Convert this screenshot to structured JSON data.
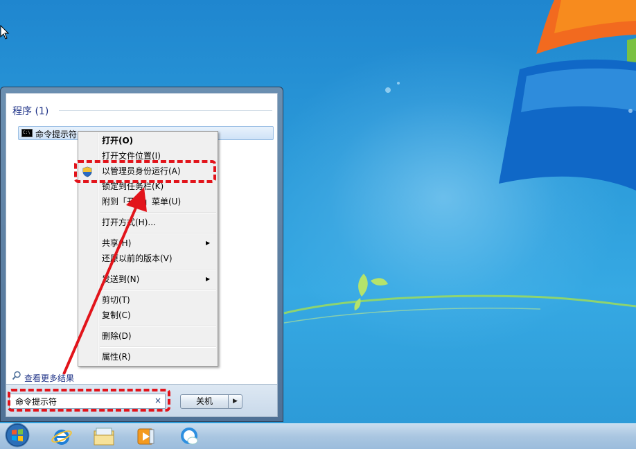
{
  "start_menu": {
    "group_header": "程序 (1)",
    "program_item": "命令提示符",
    "cmd_icon_text": "C:\\",
    "see_more": "查看更多结果",
    "search_value": "命令提示符",
    "search_clear": "×",
    "shutdown_label": "关机",
    "shutdown_arrow": "▶"
  },
  "context_menu": {
    "items": [
      {
        "label": "打开(O)"
      },
      {
        "label": "打开文件位置(I)"
      },
      {
        "label": "以管理员身份运行(A)"
      },
      {
        "label": "锁定到任务栏(K)"
      },
      {
        "label": "附到「开始」菜单(U)"
      },
      {
        "label": "打开方式(H)..."
      },
      {
        "label": "共享(H)"
      },
      {
        "label": "还原以前的版本(V)"
      },
      {
        "label": "发送到(N)"
      },
      {
        "label": "剪切(T)"
      },
      {
        "label": "复制(C)"
      },
      {
        "label": "删除(D)"
      },
      {
        "label": "属性(R)"
      }
    ],
    "submenu_arrow": "▶"
  },
  "taskbar": {
    "icons": [
      "windows-orb-icon",
      "internet-explorer-icon",
      "windows-explorer-icon",
      "media-player-icon",
      "weather-browser-icon"
    ]
  },
  "colors": {
    "annotation_red": "#e2141b",
    "desktop_blue": "#2b9ad9",
    "menu_header_blue": "#1e3287"
  }
}
